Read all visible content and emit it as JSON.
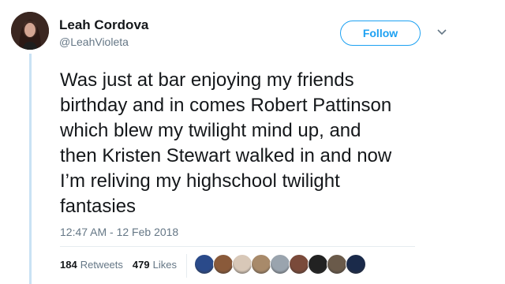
{
  "author": {
    "name": "Leah Cordova",
    "handle": "@LeahVioleta",
    "avatar_icon": "profile-photo-avatar"
  },
  "follow_button": {
    "label": "Follow",
    "color": "#1da1f2"
  },
  "menu": {
    "icon": "chevron-down-icon"
  },
  "tweet": {
    "text": "Was just at bar enjoying my friends\nbirthday and in comes Robert Pattinson\nwhich blew my twilight mind up, and\nthen Kristen Stewart walked in and now\nI’m reliving my highschool twilight\nfantasies",
    "timestamp": "12:47 AM - 12 Feb 2018"
  },
  "stats": {
    "retweets_count": "184",
    "retweets_label": "Retweets",
    "likes_count": "479",
    "likes_label": "Likes"
  },
  "likers": {
    "count": 9,
    "colors": [
      "#2a4a8a",
      "#8a5a3a",
      "#d8c8b8",
      "#a88a6a",
      "#9aa4ae",
      "#7a4a3a",
      "#222222",
      "#6a5a4a",
      "#1a2a4a"
    ]
  },
  "colors": {
    "text": "#14171a",
    "secondary": "#657786",
    "rule": "#c9e2f4"
  }
}
